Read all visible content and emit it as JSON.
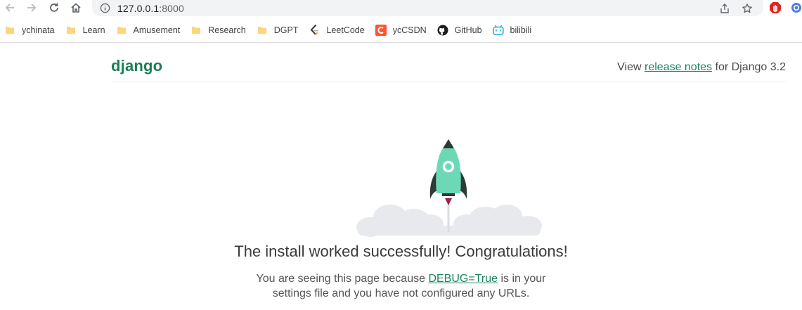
{
  "browser": {
    "url_host": "127.0.0.1",
    "url_port": ":8000",
    "bookmarks": [
      {
        "label": "ychinata",
        "icon": "folder-icon"
      },
      {
        "label": "Learn",
        "icon": "folder-icon"
      },
      {
        "label": "Amusement",
        "icon": "folder-icon"
      },
      {
        "label": "Research",
        "icon": "folder-icon"
      },
      {
        "label": "DGPT",
        "icon": "folder-icon"
      },
      {
        "label": "LeetCode",
        "icon": "leetcode-icon"
      },
      {
        "label": "ycCSDN",
        "icon": "csdn-icon"
      },
      {
        "label": "GitHub",
        "icon": "github-icon"
      },
      {
        "label": "bilibili",
        "icon": "bilibili-icon"
      }
    ]
  },
  "page": {
    "logo": "django",
    "release_prefix": "View ",
    "release_link": "release notes",
    "release_suffix": " for Django 3.2",
    "title": "The install worked successfully! Congratulations!",
    "text_prefix": "You are seeing this page because ",
    "debug_link": "DEBUG=True",
    "text_line1_suffix": " is in your",
    "text_line2": "settings file and you have not configured any URLs."
  },
  "colors": {
    "django_green": "#19865c",
    "rocket_body": "#6dd8b6",
    "rocket_dark": "#2c3b36",
    "flame": "#a01e44",
    "cloud": "#e7e9ec"
  }
}
